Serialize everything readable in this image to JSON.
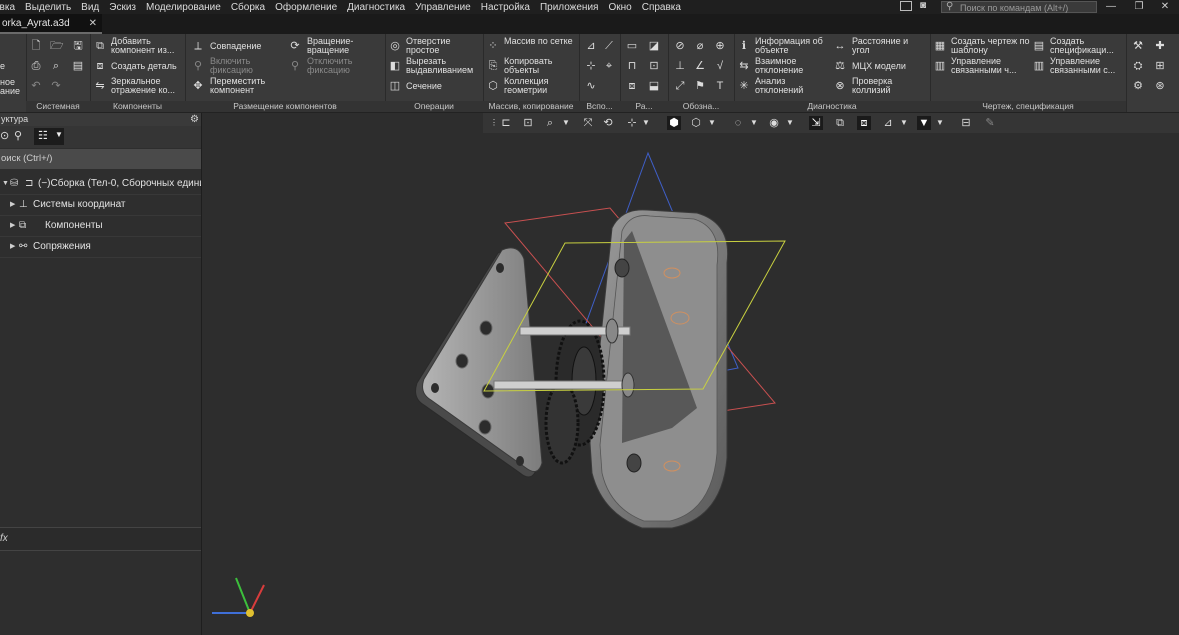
{
  "menu": [
    "авка",
    "Выделить",
    "Вид",
    "Эскиз",
    "Моделирование",
    "Сборка",
    "Оформление",
    "Диагностика",
    "Управление",
    "Настройка",
    "Приложения",
    "Окно",
    "Справка"
  ],
  "command_search": {
    "placeholder": "Поиск по командам (Alt+/)"
  },
  "window_buttons": {
    "minimize": "—",
    "restore": "❐",
    "close": "✕"
  },
  "doc_tab": {
    "title": "orka_Ayrat.a3d",
    "close": "✕"
  },
  "ribbon": {
    "system": {
      "title": "Системная",
      "label_1": "е",
      "label_2": "ное",
      "label_3": "ание"
    },
    "components": {
      "title": "Компоненты",
      "add": "Добавить компонент из...",
      "create_part": "Создать деталь",
      "mirror": "Зеркальное отражение ко..."
    },
    "placement": {
      "title": "Размещение компонентов",
      "coincidence": "Совпадение",
      "enable_fix": "Включить фиксацию",
      "move": "Переместить компонент",
      "rotate": "Вращение-вращение",
      "disable_fix": "Отключить фиксацию"
    },
    "operations": {
      "title": "Операции",
      "hole": "Отверстие простое",
      "cut_extrude": "Вырезать выдавливанием",
      "section": "Сечение"
    },
    "array": {
      "title": "Массив, копирование",
      "grid": "Массив по сетке",
      "copy": "Копировать объекты",
      "collection": "Коллекция геометрии"
    },
    "aux": {
      "title": "Вспо..."
    },
    "ra": {
      "title": "Ра..."
    },
    "notation": {
      "title": "Обозна..."
    },
    "diagnostics": {
      "title": "Диагностика",
      "info": "Информация об объекте",
      "mutual": "Взаимное отклонение",
      "analysis": "Анализ отклонений",
      "distance": "Расстояние и угол",
      "mcx": "МЦХ модели",
      "collisions": "Проверка коллизий"
    },
    "drawing": {
      "title": "Чертеж, спецификация",
      "create_drawing": "Создать чертеж по шаблону",
      "manage_linked": "Управление связанными ч...",
      "create_spec": "Создать спецификаци...",
      "manage_linked_spec": "Управление связанными с..."
    }
  },
  "left_panel": {
    "title": "уктура",
    "search": "оиск (Ctrl+/)",
    "tree": [
      {
        "label": "(−)Сборка (Тел-0, Сборочных едини"
      },
      {
        "label": "Системы координат"
      },
      {
        "label": "Компоненты"
      },
      {
        "label": "Сопряжения"
      }
    ],
    "bottom_label": "fx"
  },
  "colors": {
    "bg": "#2b2b2b",
    "ribbon": "#3a3a3a",
    "plane_blue": "#3f5fc8",
    "plane_red": "#c85050",
    "plane_yellow": "#c8d040"
  }
}
